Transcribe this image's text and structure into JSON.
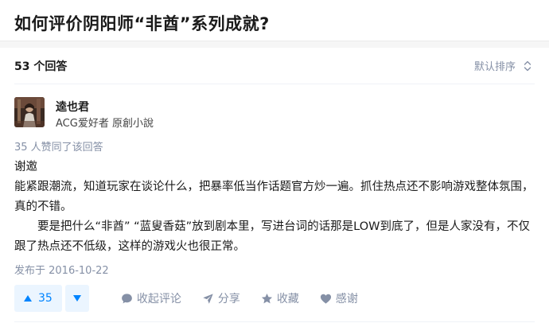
{
  "question": {
    "title": "如何评价阴阳师“非酋”系列成就?"
  },
  "answers_bar": {
    "count_label": "53 个回答",
    "sort_label": "默认排序",
    "sort_icon": "sort-arrows-icon"
  },
  "answer": {
    "author": {
      "name": "逵也君",
      "bio": "ACG爱好者 原創小說",
      "avatar_icon": "avatar"
    },
    "vote_meta": "35 人赞同了该回答",
    "paragraphs": [
      "谢邀",
      "能紧跟潮流，知道玩家在谈论什么，把暴率低当作话题官方炒一遍。抓住热点还不影响游戏整体氛围，真的不错。",
      "要是把什么“非酋” “蓝叟香菇”放到剧本里，写进台词的话那是LOW到底了，但是人家没有，不仅跟了热点还不低级，这样的游戏火也很正常。"
    ],
    "publish_date": "发布于 2016-10-22",
    "actions": {
      "upvote_count": "35",
      "comment_label": "收起评论",
      "share_label": "分享",
      "favorite_label": "收藏",
      "thanks_label": "感谢"
    },
    "colors": {
      "accent": "#0084ff",
      "accent_bg": "#ebf5ff",
      "muted": "#8590a6"
    }
  }
}
